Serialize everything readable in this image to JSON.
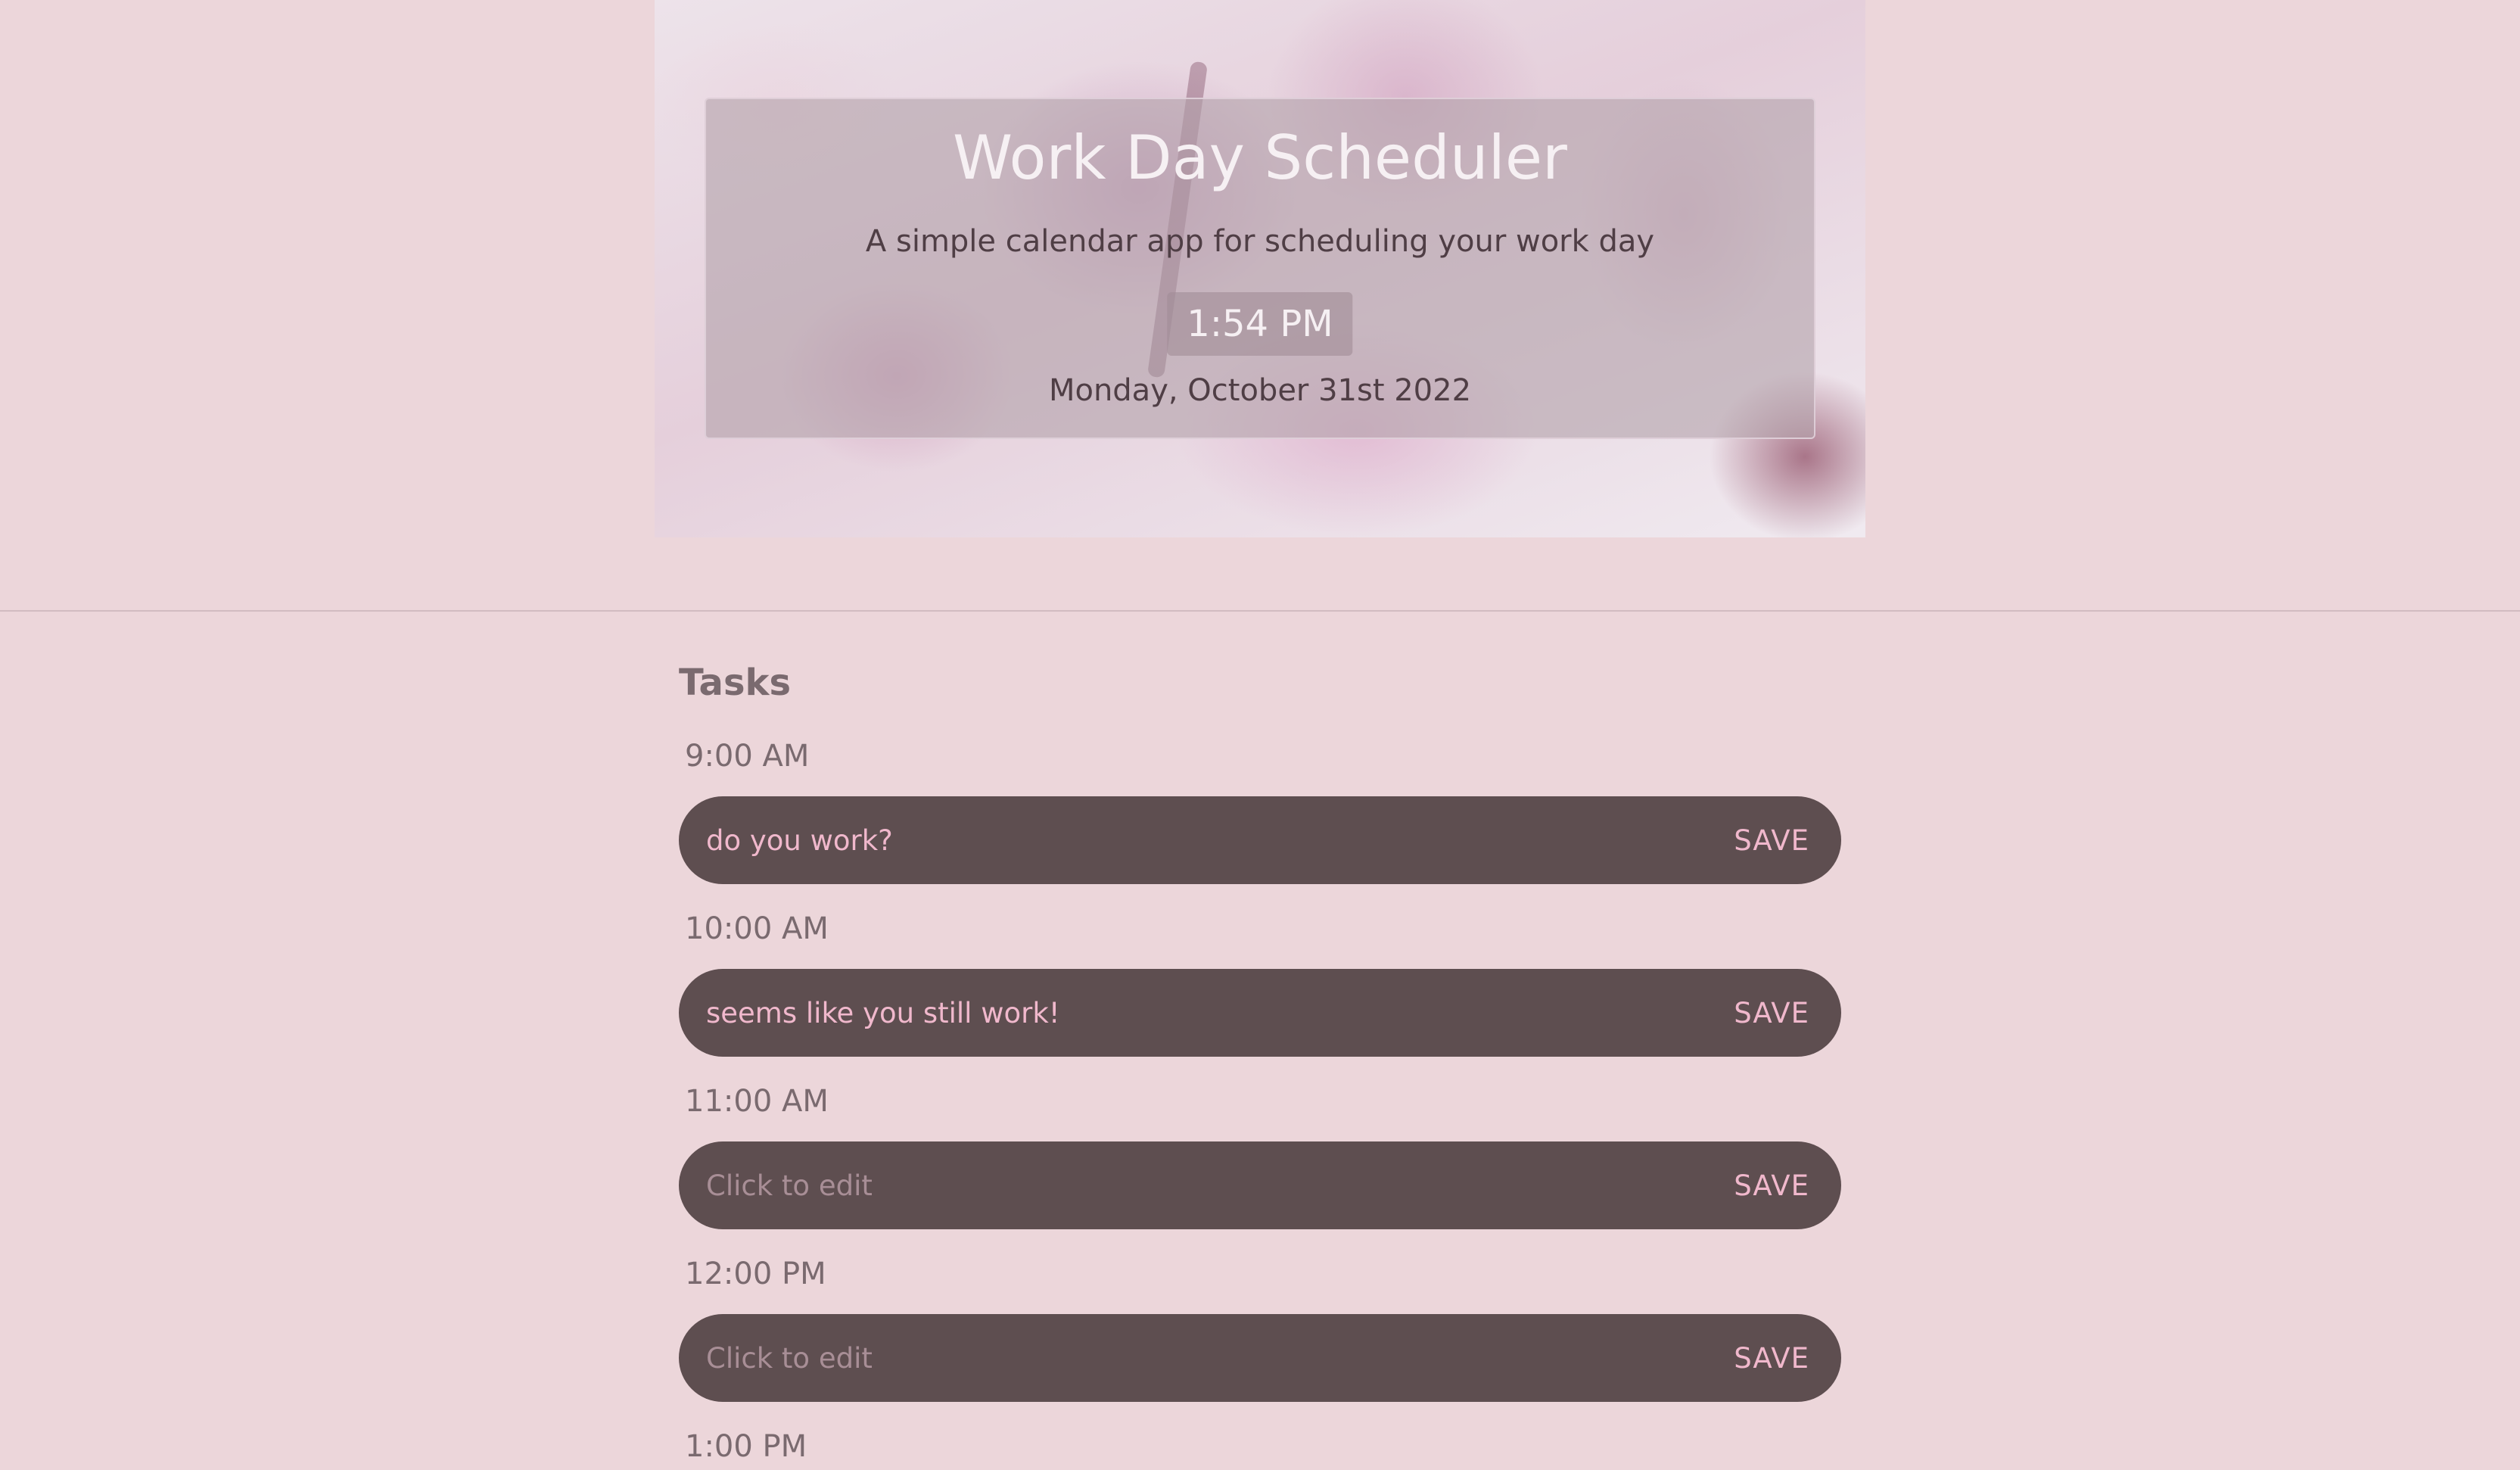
{
  "header": {
    "title": "Work Day Scheduler",
    "subtitle": "A simple calendar app for scheduling your work day",
    "time": "1:54 PM",
    "date": "Monday, October 31st 2022"
  },
  "tasks": {
    "heading": "Tasks",
    "save_label": "SAVE",
    "placeholder": "Click to edit",
    "slots": [
      {
        "time": "9:00 AM",
        "value": "do you work?"
      },
      {
        "time": "10:00 AM",
        "value": "seems like you still work!"
      },
      {
        "time": "11:00 AM",
        "value": ""
      },
      {
        "time": "12:00 PM",
        "value": ""
      },
      {
        "time": "1:00 PM",
        "value": ""
      }
    ]
  },
  "colors": {
    "page_background": "#ecd6da",
    "task_bar": "#5e4e50",
    "accent_text": "#f0b8cc"
  }
}
